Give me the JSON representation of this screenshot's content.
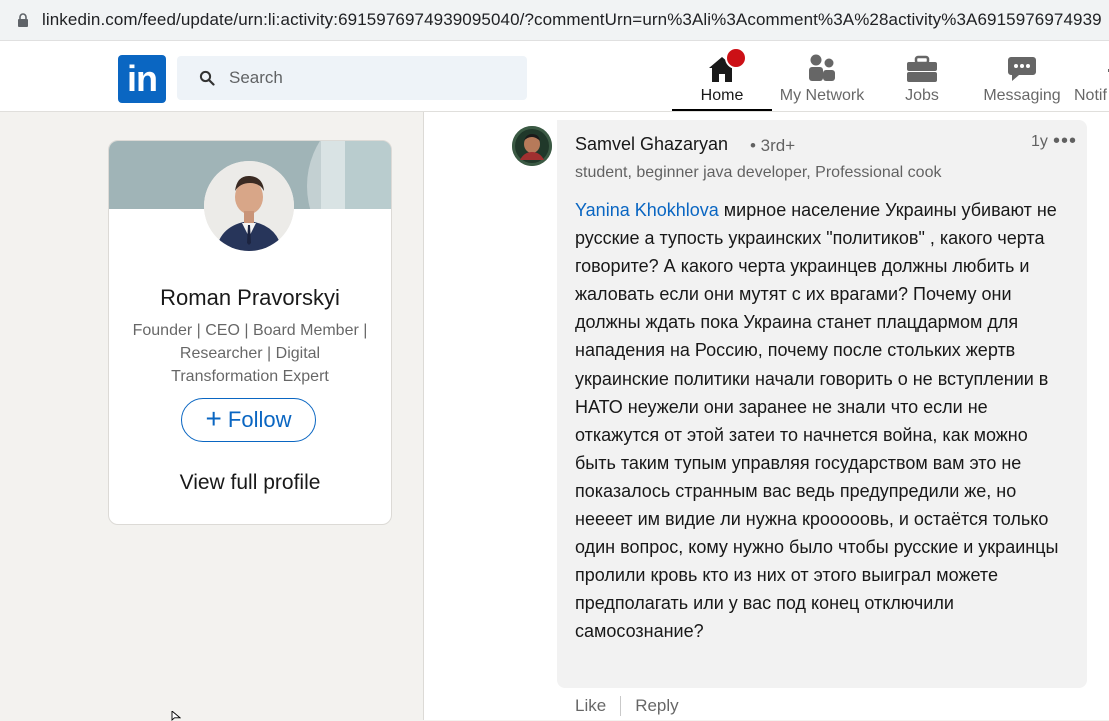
{
  "browser": {
    "url": "linkedin.com/feed/update/urn:li:activity:6915976974939095040/?commentUrn=urn%3Ali%3Acomment%3A%28activity%3A6915976974939"
  },
  "nav": {
    "logo_text": "in",
    "search_placeholder": "Search",
    "items": [
      {
        "label": "Home",
        "icon": "home-icon",
        "badge": "",
        "active": true
      },
      {
        "label": "My Network",
        "icon": "people-icon"
      },
      {
        "label": "Jobs",
        "icon": "briefcase-icon"
      },
      {
        "label": "Messaging",
        "icon": "chat-icon"
      },
      {
        "label": "Notif",
        "icon": "bell-icon"
      }
    ]
  },
  "profile_card": {
    "name": "Roman Pravorskyi",
    "headline": "Founder | CEO | Board Member | Researcher | Digital Transformation Expert",
    "follow_label": "Follow",
    "follow_icon": "plus-icon",
    "view_profile_label": "View full profile"
  },
  "comment": {
    "author": "Samvel Ghazaryan",
    "degree": "• 3rd+",
    "headline": "student, beginner java developer, Professional cook",
    "time": "1y",
    "mention": "Yanina Khokhlova",
    "text": "мирное население Украины убивают не русские а тупость украинских \"политиков\" , какого черта говорите? А какого черта украинцев должны любить и жаловать если они мутят с их врагами? Почему они должны ждать пока Украина станет плацдармом для нападения на Россию, почему после стольких жертв украинские политики начали говорить о не вступлении в НАТО неужели они заранее не знали что если не откажутся от этой затеи то начнется война, как можно быть таким тупым управляя государством вам это не показалось странным вас ведь предупредили же, но неееет им видие ли нужна крооооовь, и остаётся только один вопрос, кому нужно было чтобы русские и украинцы пролили кровь кто из них от этого выиграл можете предполагать или у вас под конец отключили самосознание?",
    "actions": {
      "like": "Like",
      "reply": "Reply"
    }
  },
  "colors": {
    "brand": "#0a66c2",
    "background": "#f3f2ef",
    "badge": "#cc1016"
  }
}
